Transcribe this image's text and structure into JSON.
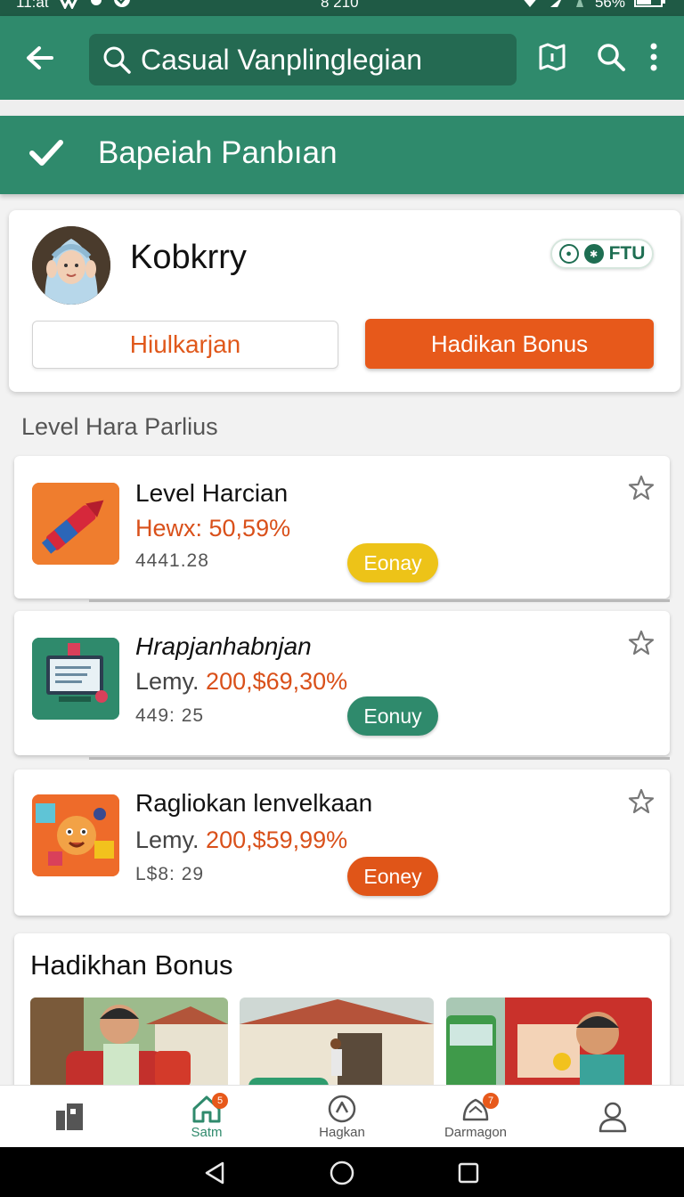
{
  "status_bar": {
    "time": "11:at",
    "center_text": "8 210",
    "battery": "56%"
  },
  "app_bar": {
    "search_text": "Casual Vanplinglegian"
  },
  "banner": {
    "title": "Bapeiah Panbıan"
  },
  "profile": {
    "name": "Kobkrry",
    "badge_text": "FTU",
    "button_secondary": "Hiulkarjan",
    "button_primary": "Hadikan Bonus"
  },
  "section_label": "Level Hara Parlius",
  "levels": [
    {
      "title": "Level Harcian",
      "rate_prefix": "",
      "rate_value": "Hewx: 50,59%",
      "meta": "4441.28",
      "pill": "Eonay",
      "pill_color": "#edc318",
      "thumb_icon": "crayon-icon"
    },
    {
      "title": "Hrapjanhabnjan",
      "rate_prefix": "Lemy.",
      "rate_value": "200,$69,30%",
      "meta": "449: 25",
      "pill": "Eonuy",
      "pill_color": "#2f8a6c",
      "thumb_icon": "computer-icon"
    },
    {
      "title": "Ragliokan lenvelkaan",
      "rate_prefix": "Lemy.",
      "rate_value": "200,$59,99%",
      "meta": "L$8: 29",
      "pill": "Eoney",
      "pill_color": "#e05518",
      "thumb_icon": "mascot-icon"
    }
  ],
  "bonus": {
    "title": "Hadikhan Bonus"
  },
  "bottom_nav": [
    {
      "label": "",
      "icon": "grid-icon"
    },
    {
      "label": "Satm",
      "icon": "home-icon",
      "badge": "5",
      "active": true
    },
    {
      "label": "Hagkan",
      "icon": "compass-icon"
    },
    {
      "label": "Darmagon",
      "icon": "bell-person-icon",
      "badge": "7"
    },
    {
      "label": "",
      "icon": "profile-icon"
    }
  ],
  "colors": {
    "primary_green": "#2f8a6c",
    "accent_orange": "#e7591b",
    "yellow": "#edc318"
  }
}
